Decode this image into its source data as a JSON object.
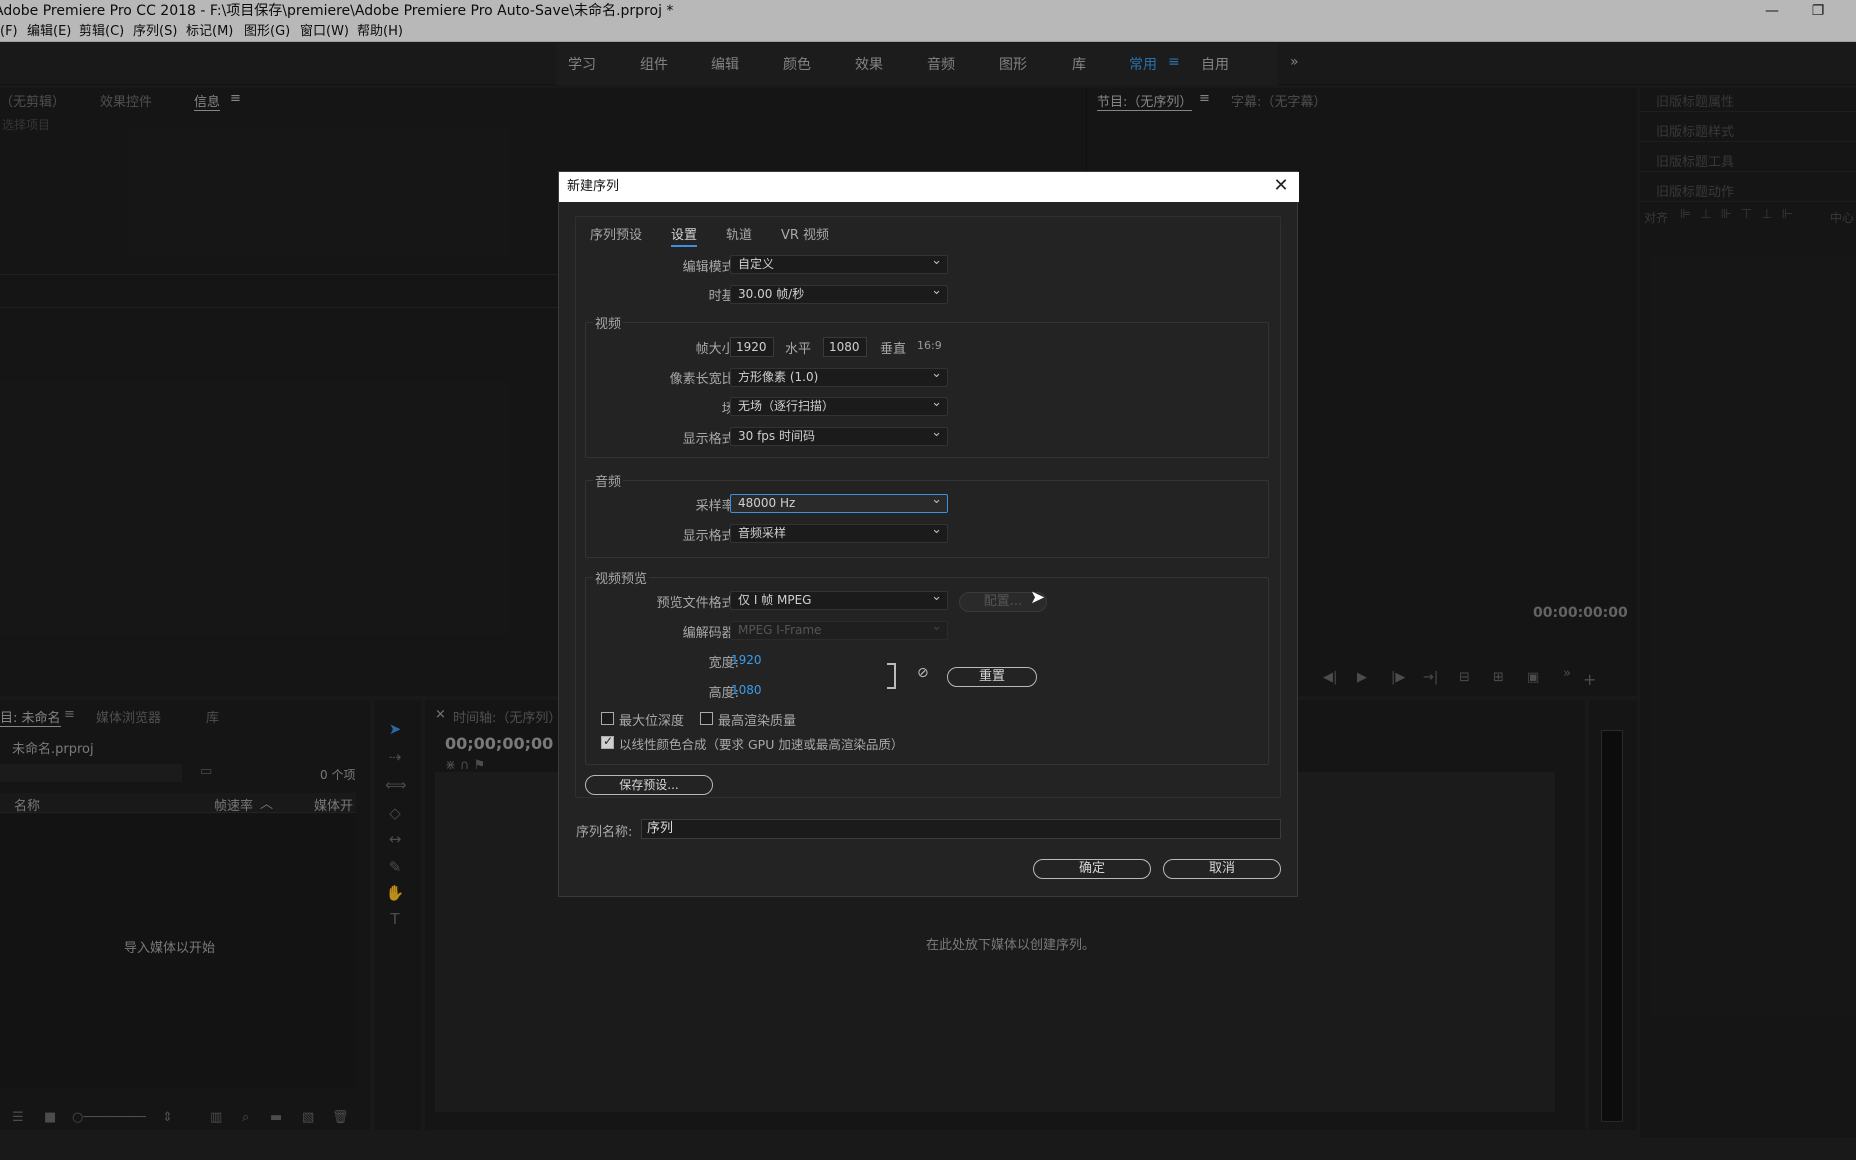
{
  "window": {
    "title": "Adobe Premiere Pro CC 2018 - F:\\项目保存\\premiere\\Adobe Premiere Pro Auto-Save\\未命名.prproj *",
    "minimize": "—",
    "restore": "❐"
  },
  "menu": [
    "(F)",
    "编辑(E)",
    "剪辑(C)",
    "序列(S)",
    "标记(M)",
    "图形(G)",
    "窗口(W)",
    "帮助(H)"
  ],
  "workspaces": [
    "学习",
    "组件",
    "编辑",
    "颜色",
    "效果",
    "音频",
    "图形",
    "库",
    "常用",
    "自用"
  ],
  "workspace_active": "常用",
  "workspace_more": "»",
  "source_panel": {
    "tabs": [
      "（无剪辑）",
      "效果控件",
      "信息"
    ],
    "hint": "选择项目",
    "menu": "≡"
  },
  "program_panel": {
    "tabs": [
      "节目:（无序列）",
      "字幕:（无字幕）"
    ],
    "timecode": "00:00:00:00",
    "menu": "≡"
  },
  "legacy_title_panels": [
    "旧版标题属性",
    "旧版标题样式",
    "旧版标题工具",
    "旧版标题动作"
  ],
  "align_label": "对齐",
  "center_label": "中心",
  "project_panel": {
    "tabs": [
      "目: 未命名",
      "媒体浏览器",
      "库"
    ],
    "file": "未命名.prproj",
    "item_count": "0 个项",
    "columns": [
      "名称",
      "帧速率",
      "媒体开"
    ],
    "empty_hint": "导入媒体以开始"
  },
  "timeline_panel": {
    "tab": "时间轴:（无序列）",
    "close": "×",
    "timecode": "00;00;00;00",
    "drop_hint": "在此处放下媒体以创建序列。"
  },
  "dialog": {
    "title": "新建序列",
    "close": "✕",
    "tabs": [
      "序列预设",
      "设置",
      "轨道",
      "VR 视频"
    ],
    "active_tab": "设置",
    "editing_mode_label": "编辑模式:",
    "editing_mode": "自定义",
    "timebase_label": "时基:",
    "timebase": "30.00  帧/秒",
    "video_group": "视频",
    "frame_size_label": "帧大小:",
    "frame_width": "1920",
    "horizontal_label": "水平",
    "frame_height": "1080",
    "vertical_label": "垂直",
    "aspect": "16:9",
    "pixel_aspect_label": "像素长宽比:",
    "pixel_aspect": "方形像素 (1.0)",
    "fields_label": "场:",
    "fields": "无场（逐行扫描）",
    "video_display_label": "显示格式:",
    "video_display": "30 fps 时间码",
    "audio_group": "音频",
    "sample_rate_label": "采样率:",
    "sample_rate": "48000 Hz",
    "audio_display_label": "显示格式:",
    "audio_display": "音频采样",
    "preview_group": "视频预览",
    "preview_format_label": "预览文件格式:",
    "preview_format": "仅 I 帧 MPEG",
    "configure_button": "配置...",
    "codec_label": "编解码器:",
    "codec": "MPEG I-Frame",
    "width_label": "宽度:",
    "width": "1920",
    "height_label": "高度:",
    "height": "1080",
    "reset_button": "重置",
    "max_bit_depth": "最大位深度",
    "max_render_quality": "最高渲染质量",
    "linear_color": "以线性颜色合成（要求 GPU 加速或最高渲染品质）",
    "linear_color_checked": true,
    "save_preset_button": "保存预设...",
    "sequence_name_label": "序列名称:",
    "sequence_name": "序列",
    "ok_button": "确定",
    "cancel_button": "取消"
  }
}
